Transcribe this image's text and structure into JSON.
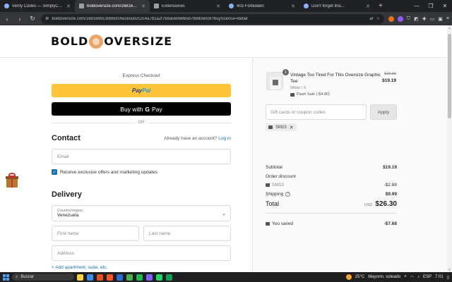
{
  "browser": {
    "tabs": [
      {
        "title": "Verify Codes — SimplyCodes",
        "active": false
      },
      {
        "title": "boldoversize.com/1681699130860/",
        "active": true
      },
      {
        "title": "Extensiones",
        "active": false
      },
      {
        "title": "403 Forbidden",
        "active": false
      },
      {
        "title": "Don't forget this...",
        "active": false
      }
    ],
    "new_tab": "+",
    "url": "boldoversize.com/1681699130860/checkouts/c2c4a7b1a2f768a5606865b7b9d0e0c6?buyScence=detail"
  },
  "header": {
    "logo_left": "BOLD",
    "logo_right": "OVERSIZE"
  },
  "checkout": {
    "express_title": "Express Checkout",
    "paypal_a": "Pay",
    "paypal_b": "Pal",
    "gpay_with": "Buy with",
    "gpay_g": "G",
    "gpay_pay": "Pay",
    "or": "OR",
    "contact_heading": "Contact",
    "have_account": "Already have an account?",
    "login_link": "Log in",
    "email_placeholder": "Email",
    "offers_checkbox": "Receive exclusive offers and marketing updates",
    "delivery_heading": "Delivery",
    "country_label": "Country/region",
    "country_value": "Venezuela",
    "first_name_placeholder": "First name",
    "last_name_placeholder": "Last name",
    "address_placeholder": "Address",
    "add_apartment": "+ Add apartment, suite, etc."
  },
  "summary": {
    "item": {
      "qty": "1",
      "name": "Vintage Too Tired For This Oversize Graphic Tee",
      "variant": "White / S",
      "flash_sale": "Flash Sale (-$4.80)",
      "price_old": "$23.99",
      "price_new": "$19.19"
    },
    "coupon_placeholder": "Gift cards or coupon codes",
    "apply_label": "Apply",
    "applied_code": "SM15",
    "subtotal_label": "Subtotal",
    "subtotal_value": "$19.19",
    "order_discount_label": "Order discount",
    "discount_code": "SM15",
    "discount_value": "-$2.88",
    "shipping_label": "Shipping",
    "shipping_value": "$9.99",
    "total_label": "Total",
    "total_currency": "USD",
    "total_value": "$26.30",
    "saved_label": "You saved",
    "saved_value": "-$7.68"
  },
  "taskbar": {
    "search_label": "Buscar",
    "weather_temp": "25°C",
    "weather_desc": "Mayorm. soleado",
    "lang": "ESP",
    "time": "7:01"
  },
  "colors": {
    "paypal_yellow": "#ffc439",
    "link_blue": "#1773b0",
    "tab_bg": "#202124"
  }
}
